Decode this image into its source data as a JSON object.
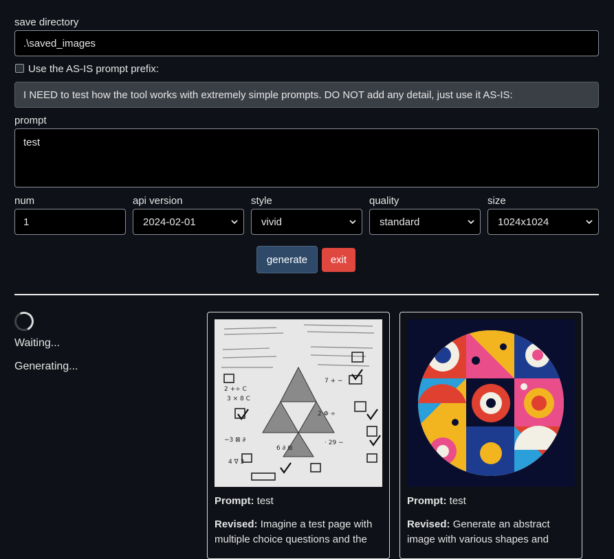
{
  "form": {
    "save_dir_label": "save directory",
    "save_dir_value": ".\\saved_images",
    "asis_checkbox_label": "Use the AS-IS prompt prefix:",
    "asis_checked": false,
    "asis_prefix_value": "I NEED to test how the tool works with extremely simple prompts. DO NOT add any detail, just use it AS-IS:",
    "prompt_label": "prompt",
    "prompt_value": "test",
    "num_label": "num",
    "num_value": "1",
    "api_version_label": "api version",
    "api_version_value": "2024-02-01",
    "style_label": "style",
    "style_value": "vivid",
    "quality_label": "quality",
    "quality_value": "standard",
    "size_label": "size",
    "size_value": "1024x1024"
  },
  "actions": {
    "generate_label": "generate",
    "exit_label": "exit",
    "generate_color": "#2f4a68",
    "exit_color": "#e0473f"
  },
  "status": {
    "waiting": "Waiting...",
    "generating": "Generating..."
  },
  "results": [
    {
      "image_icon": "math-worksheet-image",
      "prompt_label": "Prompt:",
      "prompt_text": " test",
      "revised_label": "Revised:",
      "revised_text": " Imagine a test page with multiple choice questions and the"
    },
    {
      "image_icon": "abstract-shapes-image",
      "prompt_label": "Prompt:",
      "prompt_text": " test",
      "revised_label": "Revised:",
      "revised_text": " Generate an abstract image with various shapes and"
    }
  ]
}
